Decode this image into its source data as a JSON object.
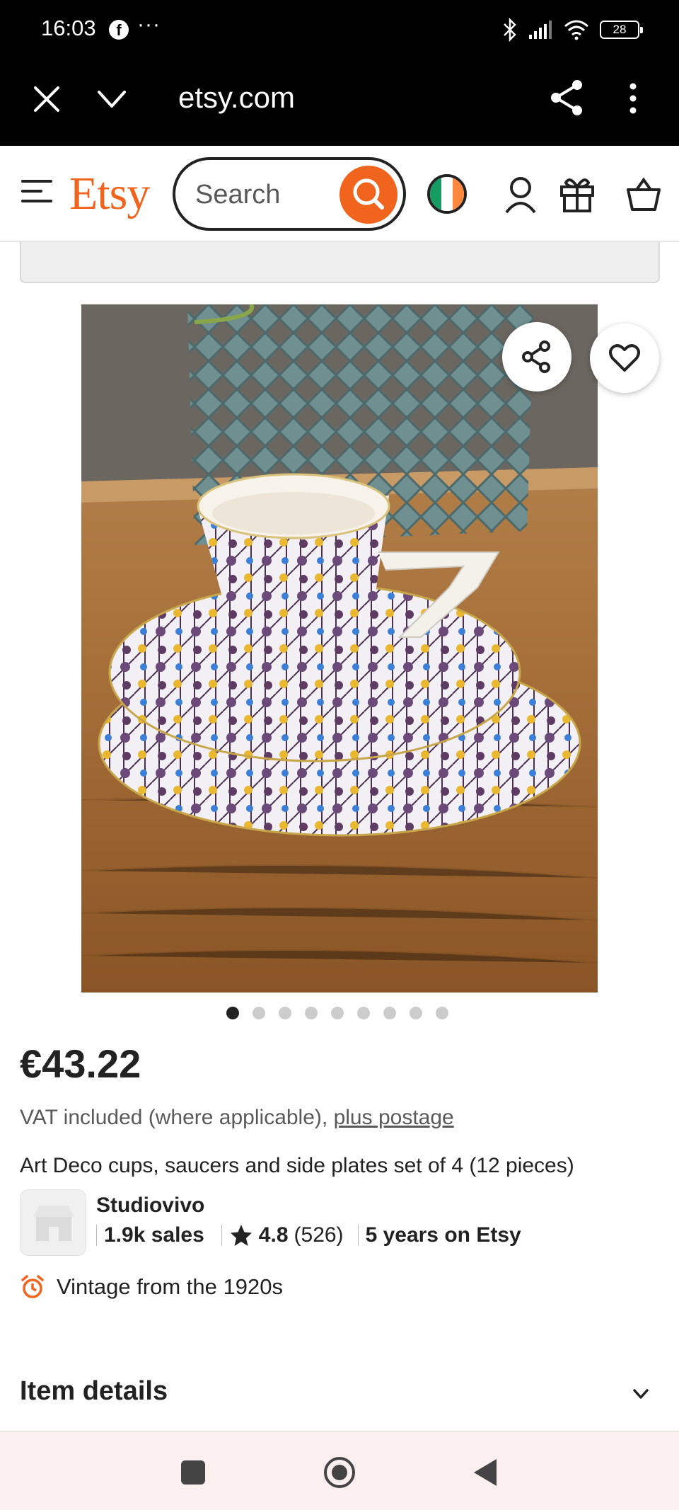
{
  "status_bar": {
    "time": "16:03",
    "more": "···",
    "battery": "28"
  },
  "browser": {
    "url": "etsy.com"
  },
  "header": {
    "logo": "Etsy",
    "search_placeholder": "Search"
  },
  "listing": {
    "price": "€43.22",
    "vat_text": "VAT included (where applicable), ",
    "postage_link": "plus postage",
    "title": "Art Deco cups, saucers and side plates set of 4 (12 pieces)",
    "image_count": 9,
    "active_image": 1
  },
  "shop": {
    "name": "Studiovivo",
    "sales": "1.9k sales",
    "rating": "4.8",
    "reviews": "(526)",
    "tenure": "5 years on Etsy"
  },
  "vintage": {
    "text": "Vintage from the 1920s"
  },
  "details": {
    "label": "Item details"
  },
  "colors": {
    "etsy_orange": "#f1641e",
    "text": "#222222",
    "muted": "#595959"
  }
}
